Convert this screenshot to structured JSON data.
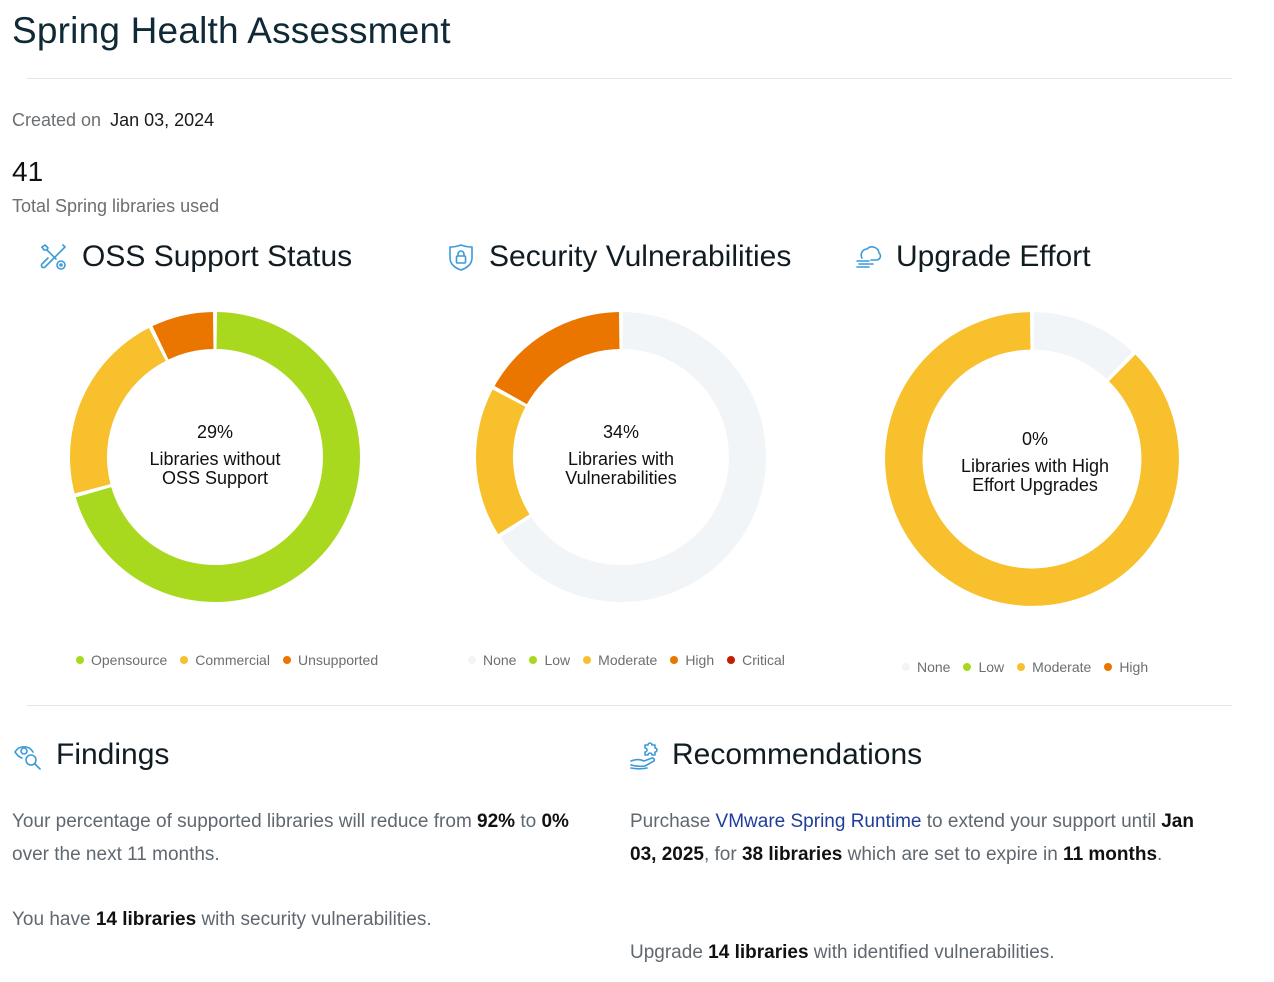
{
  "page": {
    "title": "Spring Health Assessment",
    "created_label": "Created on",
    "created_date": "Jan 03, 2024",
    "total_libraries": "41",
    "total_libraries_label": "Total Spring libraries used"
  },
  "colors": {
    "accent_icon": "#3a9bd9",
    "opensource": "#a8d91f",
    "commercial": "#f7c02c",
    "unsupported": "#ea7600",
    "none": "#f2f5f8",
    "low": "#a8d91f",
    "moderate": "#f7c02c",
    "high": "#ea7600",
    "critical": "#c21d00",
    "link": "#1f3e9c"
  },
  "sections": {
    "oss": {
      "title": "OSS Support Status",
      "icon": "tools-icon",
      "center_pct": "29%",
      "center_line1": "Libraries without",
      "center_line2": "OSS Support"
    },
    "security": {
      "title": "Security Vulnerabilities",
      "icon": "shield-lock-icon",
      "center_pct": "34%",
      "center_line1": "Libraries with",
      "center_line2": "Vulnerabilities"
    },
    "upgrade": {
      "title": "Upgrade Effort",
      "icon": "cloud-upgrade-icon",
      "center_pct": "0%",
      "center_line1": "Libraries with High",
      "center_line2": "Effort Upgrades"
    }
  },
  "chart_data": [
    {
      "type": "pie",
      "title": "OSS Support Status",
      "donut": true,
      "categories": [
        "Opensource",
        "Commercial",
        "Unsupported"
      ],
      "values": [
        29,
        9,
        3
      ],
      "colors": [
        "#a8d91f",
        "#f7c02c",
        "#ea7600"
      ],
      "center_label": "29% Libraries without OSS Support",
      "legend": "bottom"
    },
    {
      "type": "pie",
      "title": "Security Vulnerabilities",
      "donut": true,
      "categories": [
        "None",
        "Low",
        "Moderate",
        "High",
        "Critical"
      ],
      "values": [
        27,
        0,
        7,
        7,
        0
      ],
      "colors": [
        "#f2f5f8",
        "#a8d91f",
        "#f7c02c",
        "#ea7600",
        "#c21d00"
      ],
      "center_label": "34% Libraries with Vulnerabilities",
      "legend": "bottom"
    },
    {
      "type": "pie",
      "title": "Upgrade Effort",
      "donut": true,
      "categories": [
        "None",
        "Low",
        "Moderate",
        "High"
      ],
      "values": [
        5,
        0,
        36,
        0
      ],
      "colors": [
        "#f2f5f8",
        "#a8d91f",
        "#f7c02c",
        "#ea7600"
      ],
      "center_label": "0% Libraries with High Effort Upgrades",
      "legend": "bottom"
    }
  ],
  "findings": {
    "title": "Findings",
    "p1_a": "Your percentage of supported libraries will reduce from ",
    "p1_b": "92%",
    "p1_c": " to ",
    "p1_d": "0%",
    "p1_e": " over the next 11 months.",
    "p2_a": "You have ",
    "p2_b": "14 libraries",
    "p2_c": " with security vulnerabilities."
  },
  "recommendations": {
    "title": "Recommendations",
    "p1_a": "Purchase ",
    "p1_link": "VMware Spring Runtime",
    "p1_b": " to extend your support until ",
    "p1_c": "Jan 03, 2025",
    "p1_d": ", for ",
    "p1_e": "38 libraries",
    "p1_f": " which are set to expire in ",
    "p1_g": "11 months",
    "p1_h": ".",
    "p2_a": "Upgrade ",
    "p2_b": "14 libraries",
    "p2_c": " with identified vulnerabilities."
  }
}
